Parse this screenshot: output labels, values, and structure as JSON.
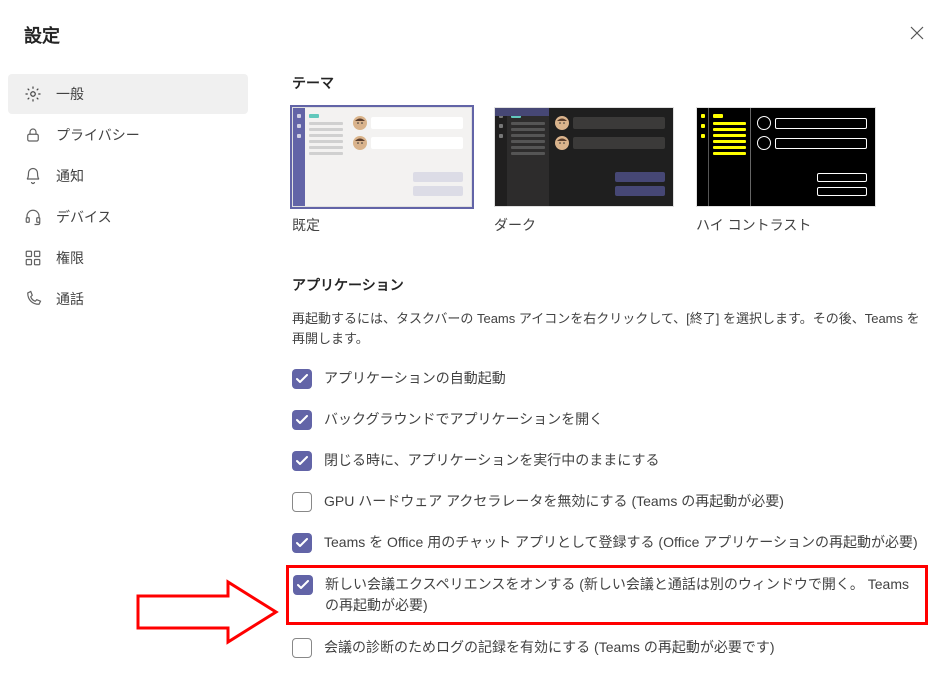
{
  "header": {
    "title": "設定"
  },
  "sidebar": {
    "items": [
      {
        "id": "general",
        "label": "一般",
        "icon": "gear",
        "active": true
      },
      {
        "id": "privacy",
        "label": "プライバシー",
        "icon": "lock",
        "active": false
      },
      {
        "id": "notifications",
        "label": "通知",
        "icon": "bell",
        "active": false
      },
      {
        "id": "devices",
        "label": "デバイス",
        "icon": "headset",
        "active": false
      },
      {
        "id": "permissions",
        "label": "権限",
        "icon": "apps",
        "active": false
      },
      {
        "id": "calls",
        "label": "通話",
        "icon": "phone",
        "active": false
      }
    ]
  },
  "themes": {
    "title": "テーマ",
    "options": [
      {
        "id": "default",
        "label": "既定",
        "selected": true
      },
      {
        "id": "dark",
        "label": "ダーク",
        "selected": false
      },
      {
        "id": "highcontrast",
        "label": "ハイ コントラスト",
        "selected": false
      }
    ]
  },
  "application": {
    "title": "アプリケーション",
    "description": "再起動するには、タスクバーの Teams アイコンを右クリックして、[終了] を選択します。その後、Teams を再開します。",
    "checkboxes": [
      {
        "id": "auto_start",
        "label": "アプリケーションの自動起動",
        "checked": true
      },
      {
        "id": "open_background",
        "label": "バックグラウンドでアプリケーションを開く",
        "checked": true
      },
      {
        "id": "keep_running",
        "label": "閉じる時に、アプリケーションを実行中のままにする",
        "checked": true
      },
      {
        "id": "disable_gpu",
        "label": "GPU ハードウェア アクセラレータを無効にする (Teams の再起動が必要)",
        "checked": false
      },
      {
        "id": "register_office",
        "label": "Teams を Office 用のチャット アプリとして登録する (Office アプリケーションの再起動が必要)",
        "checked": true
      },
      {
        "id": "new_meeting_experience",
        "label": "新しい会議エクスペリエンスをオンする (新しい会議と通話は別のウィンドウで開く。 Teams の再起動が必要)",
        "checked": true,
        "highlighted": true
      },
      {
        "id": "diagnostic_log",
        "label": "会議の診断のためログの記録を有効にする (Teams の再起動が必要です)",
        "checked": false
      }
    ]
  }
}
